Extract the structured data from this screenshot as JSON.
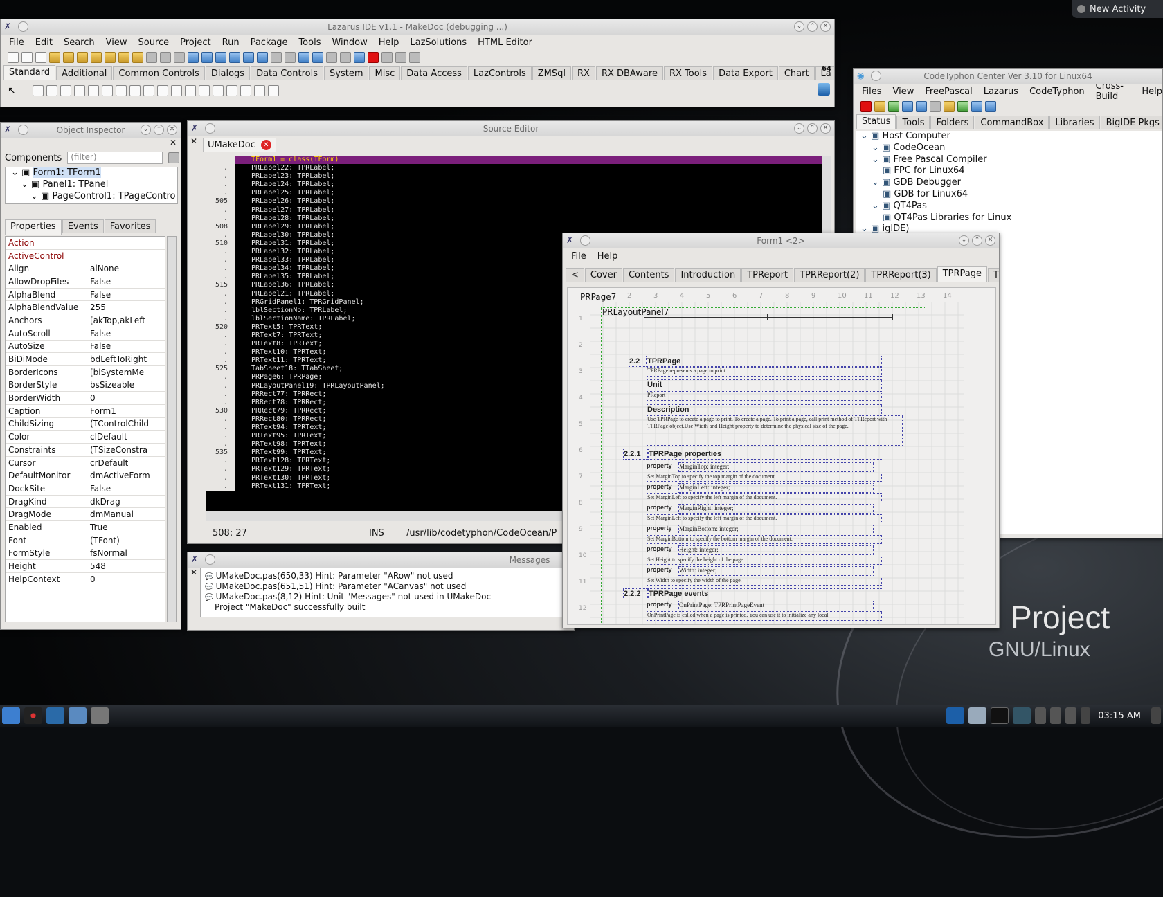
{
  "topbar": {
    "new_activity": "New Activity"
  },
  "desktop": {
    "project": "Project",
    "sub": "GNU/Linux"
  },
  "ide": {
    "title": "Lazarus IDE v1.1 - MakeDoc (debugging ...)",
    "menu": [
      "File",
      "Edit",
      "Search",
      "View",
      "Source",
      "Project",
      "Run",
      "Package",
      "Tools",
      "Window",
      "Help",
      "LazSolutions",
      "HTML Editor"
    ],
    "palette_tabs": [
      "Standard",
      "Additional",
      "Common Controls",
      "Dialogs",
      "Data Controls",
      "System",
      "Misc",
      "Data Access",
      "LazControls",
      "ZMSql",
      "RX",
      "RX DBAware",
      "RX Tools",
      "Data Export",
      "Chart",
      "La"
    ],
    "bits": "64"
  },
  "oi": {
    "title": "Object Inspector",
    "components": "Components",
    "filter": "(filter)",
    "tree": [
      "Form1: TForm1",
      "Panel1: TPanel",
      "PageControl1: TPageContro"
    ],
    "tabs": [
      "Properties",
      "Events",
      "Favorites"
    ],
    "props": [
      [
        "Action",
        ""
      ],
      [
        "ActiveControl",
        ""
      ],
      [
        "Align",
        "alNone"
      ],
      [
        "AllowDropFiles",
        "False"
      ],
      [
        "AlphaBlend",
        "False"
      ],
      [
        "AlphaBlendValue",
        "255"
      ],
      [
        "Anchors",
        "[akTop,akLeft"
      ],
      [
        "AutoScroll",
        "False"
      ],
      [
        "AutoSize",
        "False"
      ],
      [
        "BiDiMode",
        "bdLeftToRight"
      ],
      [
        "BorderIcons",
        "[biSystemMe"
      ],
      [
        "BorderStyle",
        "bsSizeable"
      ],
      [
        "BorderWidth",
        "0"
      ],
      [
        "Caption",
        "Form1"
      ],
      [
        "ChildSizing",
        "(TControlChild"
      ],
      [
        "Color",
        "clDefault"
      ],
      [
        "Constraints",
        "(TSizeConstra"
      ],
      [
        "Cursor",
        "crDefault"
      ],
      [
        "DefaultMonitor",
        "dmActiveForm"
      ],
      [
        "DockSite",
        "False"
      ],
      [
        "DragKind",
        "dkDrag"
      ],
      [
        "DragMode",
        "dmManual"
      ],
      [
        "Enabled",
        "True"
      ],
      [
        "Font",
        "(TFont)"
      ],
      [
        "FormStyle",
        "fsNormal"
      ],
      [
        "Height",
        "548"
      ],
      [
        "HelpContext",
        "0"
      ]
    ]
  },
  "editor": {
    "title": "Source Editor",
    "tab": "UMakeDoc",
    "lines": [
      [
        "",
        "TForm1 = class(TForm)"
      ],
      [
        ".",
        "PRLabel22: TPRLabel;"
      ],
      [
        ".",
        "PRLabel23: TPRLabel;"
      ],
      [
        ".",
        "PRLabel24: TPRLabel;"
      ],
      [
        ".",
        "PRLabel25: TPRLabel;"
      ],
      [
        "505",
        "PRLabel26: TPRLabel;"
      ],
      [
        ".",
        "PRLabel27: TPRLabel;"
      ],
      [
        ".",
        "PRLabel28: TPRLabel;"
      ],
      [
        "508",
        "PRLabel29: TPRLabel;"
      ],
      [
        ".",
        "PRLabel30: TPRLabel;"
      ],
      [
        "510",
        "PRLabel31: TPRLabel;"
      ],
      [
        ".",
        "PRLabel32: TPRLabel;"
      ],
      [
        ".",
        "PRLabel33: TPRLabel;"
      ],
      [
        ".",
        "PRLabel34: TPRLabel;"
      ],
      [
        ".",
        "PRLabel35: TPRLabel;"
      ],
      [
        "515",
        "PRLabel36: TPRLabel;"
      ],
      [
        ".",
        "PRLabel21: TPRLabel;"
      ],
      [
        ".",
        "PRGridPanel1: TPRGridPanel;"
      ],
      [
        ".",
        "lblSectionNo: TPRLabel;"
      ],
      [
        ".",
        "lblSectionName: TPRLabel;"
      ],
      [
        "520",
        "PRText5: TPRText;"
      ],
      [
        ".",
        "PRText7: TPRText;"
      ],
      [
        ".",
        "PRText8: TPRText;"
      ],
      [
        ".",
        "PRText10: TPRText;"
      ],
      [
        ".",
        "PRText11: TPRText;"
      ],
      [
        "525",
        "TabSheet18: TTabSheet;"
      ],
      [
        ".",
        "PRPage6: TPRPage;"
      ],
      [
        ".",
        "PRLayoutPanel19: TPRLayoutPanel;"
      ],
      [
        ".",
        "PRRect77: TPRRect;"
      ],
      [
        ".",
        "PRRect78: TPRRect;"
      ],
      [
        "530",
        "PRRect79: TPRRect;"
      ],
      [
        ".",
        "PRRect80: TPRRect;"
      ],
      [
        ".",
        "PRText94: TPRText;"
      ],
      [
        ".",
        "PRText95: TPRText;"
      ],
      [
        ".",
        "PRText98: TPRText;"
      ],
      [
        "535",
        "PRText99: TPRText;"
      ],
      [
        ".",
        "PRText128: TPRText;"
      ],
      [
        ".",
        "PRText129: TPRText;"
      ],
      [
        ".",
        "PRText130: TPRText;"
      ],
      [
        ".",
        "PRText131: TPRText;"
      ]
    ],
    "status_pos": "508: 27",
    "status_mode": "INS",
    "status_path": "/usr/lib/codetyphon/CodeOcean/P"
  },
  "messages": {
    "title": "Messages",
    "lines": [
      "UMakeDoc.pas(650,33) Hint: Parameter \"ARow\" not used",
      "UMakeDoc.pas(651,51) Hint: Parameter \"ACanvas\" not used",
      "UMakeDoc.pas(8,12) Hint: Unit \"Messages\" not used in UMakeDoc",
      "Project \"MakeDoc\" successfully built"
    ]
  },
  "ct": {
    "title": "CodeTyphon Center Ver 3.10 for Linux64",
    "menu": [
      "Files",
      "View",
      "FreePascal",
      "Lazarus",
      "CodeTyphon",
      "Cross-Build",
      "Help"
    ],
    "tabs": [
      "Status",
      "Tools",
      "Folders",
      "CommandBox",
      "Libraries",
      "BigIDE Pkgs"
    ],
    "tree": [
      "Host Computer",
      "CodeOcean",
      "Free Pascal Compiler",
      "FPC for Linux64",
      "GDB Debugger",
      "GDB for Linux64",
      "QT4Pas",
      "QT4Pas Libraries for Linux",
      "igIDE)"
    ]
  },
  "form1": {
    "title": "Form1 <2>",
    "menu": [
      "File",
      "Help"
    ],
    "tabs": [
      "Cover",
      "Contents",
      "Introduction",
      "TPReport",
      "TPRReport(2)",
      "TPRReport(3)",
      "TPRPage",
      "TPRLayoutPanel"
    ],
    "page_label": "PRPage7",
    "panel_label": "PRLayoutPanel7",
    "ruler": [
      "1",
      "2",
      "3",
      "4",
      "5",
      "6",
      "7",
      "8",
      "9",
      "10",
      "11",
      "12",
      "13",
      "14"
    ],
    "rows": [
      "1",
      "2",
      "3",
      "4",
      "5",
      "6",
      "7",
      "8",
      "9",
      "10",
      "11",
      "12"
    ],
    "doc": {
      "sec": "2.2",
      "sec_title": "TPRPage",
      "sec_desc": "TPRPage represents a page to print.",
      "unit_h": "Unit",
      "unit_v": "PReport",
      "desc_h": "Description",
      "desc_v": "Use TPRPage to create a page to print. To create a page. To print a page, call print method of TPReport with TPRPage object.Use Width and Height property to determine the physical size of the page.",
      "s1": "2.2.1",
      "s1_title": "TPRPage properties",
      "props": [
        [
          "property",
          "MarginTop: integer;",
          "Set MarginTop to specify the top margin of the document."
        ],
        [
          "property",
          "MarginLeft: integer;",
          "Set MarginLeft to specify the left margin of the document."
        ],
        [
          "property",
          "MarginRight: integer;",
          "Set MarginLeft to specify the left margin of the document."
        ],
        [
          "property",
          "MarginBottom: integer;",
          "Set MarginBottom to specify the bottom margin of the document."
        ],
        [
          "property",
          "Height: integer;",
          "Set Height to specify the height of the page."
        ],
        [
          "property",
          "Width: integer;",
          "Set Width to specify the width of the page."
        ]
      ],
      "s2": "2.2.2",
      "s2_title": "TPRPage events",
      "ev": [
        "property",
        "OnPrintPage: TPRPrintPageEvent",
        "OnPrintPage is called when a page is printed. You can use it to initialize any local"
      ]
    }
  },
  "taskbar": {
    "clock": "03:15 AM"
  }
}
